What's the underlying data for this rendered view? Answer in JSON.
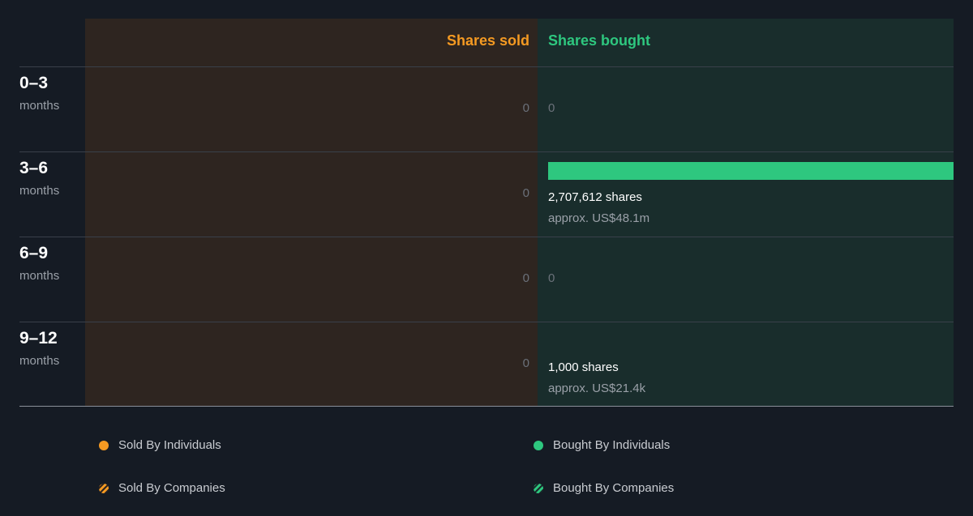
{
  "colors": {
    "background": "#151b24",
    "sold_panel": "#2e2520",
    "bought_panel": "#192d2c",
    "sold_accent": "#f59a22",
    "bought_accent": "#2ec77f"
  },
  "header": {
    "sold_label": "Shares sold",
    "bought_label": "Shares bought"
  },
  "rows": [
    {
      "period": "0–3",
      "unit": "months",
      "sold": "0",
      "bought_zero": "0",
      "bought_shares": "",
      "bought_approx": ""
    },
    {
      "period": "3–6",
      "unit": "months",
      "sold": "0",
      "bought_zero": "",
      "bought_shares": "2,707,612 shares",
      "bought_approx": "approx. US$48.1m"
    },
    {
      "period": "6–9",
      "unit": "months",
      "sold": "0",
      "bought_zero": "0",
      "bought_shares": "",
      "bought_approx": ""
    },
    {
      "period": "9–12",
      "unit": "months",
      "sold": "0",
      "bought_zero": "",
      "bought_shares": "1,000 shares",
      "bought_approx": "approx. US$21.4k"
    }
  ],
  "legend": {
    "sold_individuals": "Sold By Individuals",
    "sold_companies": "Sold By Companies",
    "bought_individuals": "Bought By Individuals",
    "bought_companies": "Bought By Companies"
  },
  "chart_data": {
    "type": "bar",
    "categories": [
      "0–3 months",
      "3–6 months",
      "6–9 months",
      "9–12 months"
    ],
    "series": [
      {
        "name": "Shares sold",
        "values": [
          0,
          0,
          0,
          0
        ]
      },
      {
        "name": "Shares bought",
        "values": [
          0,
          2707612,
          0,
          1000
        ],
        "approx_value_usd": [
          "",
          "US$48.1m",
          "",
          "US$21.4k"
        ]
      }
    ],
    "orientation": "horizontal-diverging",
    "legend_position": "bottom"
  }
}
